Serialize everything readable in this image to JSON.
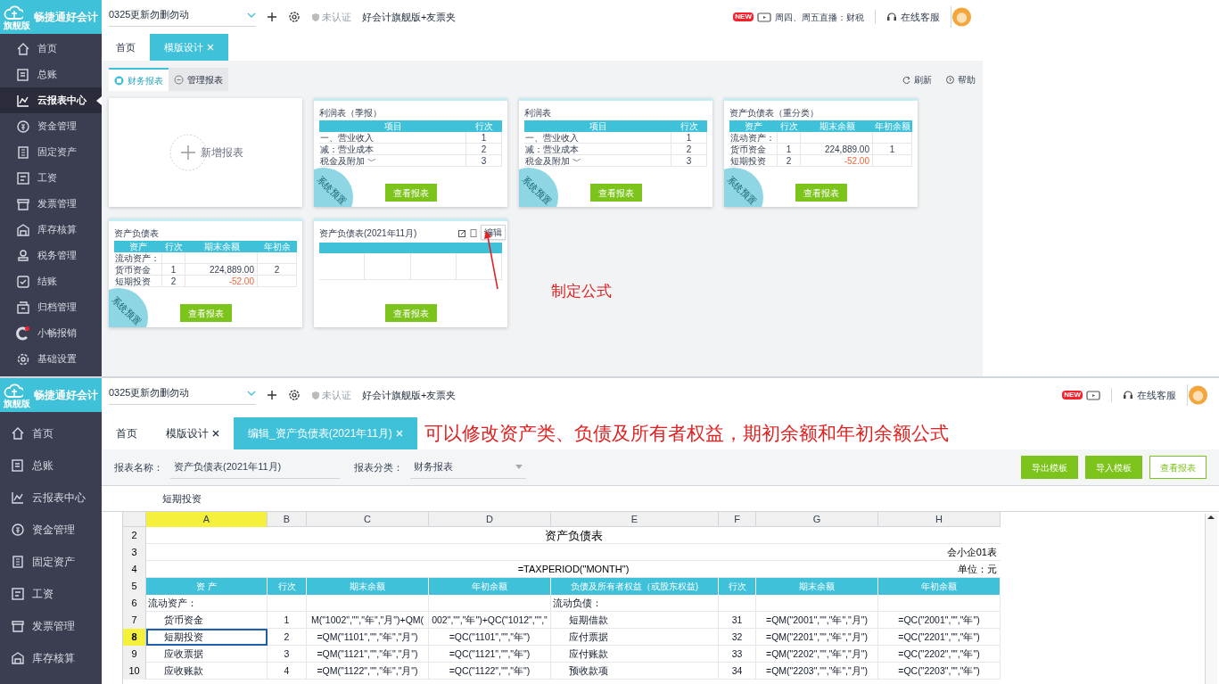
{
  "top_screen": {
    "logo": {
      "name": "畅捷通好会计",
      "edition": "旗舰版"
    },
    "sidebar": {
      "items": [
        {
          "label": "首页",
          "selected": false,
          "alert": false
        },
        {
          "label": "总账",
          "selected": false,
          "alert": false
        },
        {
          "label": "云报表中心",
          "selected": true,
          "alert": false
        },
        {
          "label": "资金管理",
          "selected": false,
          "alert": false
        },
        {
          "label": "固定资产",
          "selected": false,
          "alert": false
        },
        {
          "label": "工资",
          "selected": false,
          "alert": false
        },
        {
          "label": "发票管理",
          "selected": false,
          "alert": false
        },
        {
          "label": "库存核算",
          "selected": false,
          "alert": false
        },
        {
          "label": "税务管理",
          "selected": false,
          "alert": false
        },
        {
          "label": "结账",
          "selected": false,
          "alert": false
        },
        {
          "label": "归档管理",
          "selected": false,
          "alert": false
        },
        {
          "label": "小畅报销",
          "selected": false,
          "alert": true
        },
        {
          "label": "基础设置",
          "selected": false,
          "alert": false
        }
      ]
    },
    "header": {
      "account": "0325更新勿删勿动",
      "certification": "未认证",
      "product": "好会计旗舰版+友票夹",
      "live_badge": "NEW",
      "live": "周四、周五直播：财税",
      "support": "在线客服"
    },
    "tabs": [
      {
        "label": "首页",
        "closable": false,
        "selected": false
      },
      {
        "label": "模版设计",
        "closable": true,
        "selected": true
      }
    ],
    "subtabs": [
      {
        "label": "财务报表",
        "selected": true
      },
      {
        "label": "管理报表",
        "selected": false
      }
    ],
    "actions": [
      "刷新",
      "帮助"
    ],
    "cards": [
      {
        "kind": "add",
        "label": "新增报表"
      },
      {
        "kind": "report",
        "title": "利润表（季报）",
        "preset": "系统预置",
        "columns": [
          "项目",
          "行次"
        ],
        "rows": [
          [
            "一、营业收入",
            "1"
          ],
          [
            "减：营业成本",
            "2"
          ],
          [
            "税金及附加 ﹀",
            "3"
          ]
        ],
        "button": "查看报表"
      },
      {
        "kind": "report",
        "title": "利润表",
        "preset": "系统预置",
        "columns": [
          "项目",
          "行次"
        ],
        "rows": [
          [
            "一、营业收入",
            "1"
          ],
          [
            "减：营业成本",
            "2"
          ],
          [
            "税金及附加 ﹀",
            "3"
          ]
        ],
        "button": "查看报表"
      },
      {
        "kind": "report",
        "title": "资产负债表（重分类）",
        "preset": "系统预置",
        "columns": [
          "资产",
          "行次",
          "期末余额",
          "年初余额"
        ],
        "rows": [
          [
            "流动资产：",
            "",
            "",
            ""
          ],
          [
            "货币资金",
            "1",
            "224,889.00",
            "1"
          ],
          [
            "短期投资",
            "2",
            "-52.00",
            ""
          ]
        ],
        "button": "查看报表"
      },
      {
        "kind": "report",
        "title": "资产负债表",
        "preset": "系统预置",
        "columns": [
          "资产",
          "行次",
          "期末余额",
          "年初余"
        ],
        "rows": [
          [
            "流动资产：",
            "",
            "",
            ""
          ],
          [
            "货币资金",
            "1",
            "224,889.00",
            "2"
          ],
          [
            "短期投资",
            "2",
            "-52.00",
            ""
          ]
        ],
        "button": "查看报表"
      },
      {
        "kind": "custom",
        "title": "资产负债表(2021年11月)",
        "tooltip": "编辑",
        "button": "查看报表"
      }
    ],
    "annotation": "制定公式"
  },
  "bottom_screen": {
    "logo": {
      "name": "畅捷通好会计",
      "edition": "旗舰版"
    },
    "sidebar": {
      "items": [
        {
          "label": "首页"
        },
        {
          "label": "总账"
        },
        {
          "label": "云报表中心"
        },
        {
          "label": "资金管理"
        },
        {
          "label": "固定资产"
        },
        {
          "label": "工资"
        },
        {
          "label": "发票管理"
        },
        {
          "label": "库存核算"
        }
      ]
    },
    "header": {
      "account": "0325更新勿删勿动",
      "certification": "未认证",
      "product": "好会计旗舰版+友票夹",
      "live_badge": "NEW",
      "support": "在线客服"
    },
    "tabs": [
      {
        "label": "首页",
        "closable": false,
        "selected": false
      },
      {
        "label": "模版设计",
        "closable": true,
        "selected": false
      },
      {
        "label": "编辑_资产负债表(2021年11月)",
        "closable": true,
        "selected": true
      }
    ],
    "annotation": "可以修改资产类、负债及所有者权益，期初余额和年初余额公式",
    "form": {
      "name_label": "报表名称：",
      "name_value": "资产负债表(2021年11月)",
      "category_label": "报表分类：",
      "category_value": "财务报表"
    },
    "buttons": [
      {
        "label": "导出模板",
        "kind": "primary"
      },
      {
        "label": "导入模板",
        "kind": "primary"
      },
      {
        "label": "查看报表",
        "kind": "outline"
      }
    ],
    "formula_bar": "短期投资",
    "sheet": {
      "columns": [
        {
          "label": "A",
          "selected": true
        },
        {
          "label": "B",
          "selected": false
        },
        {
          "label": "C",
          "selected": false
        },
        {
          "label": "D",
          "selected": false
        },
        {
          "label": "E",
          "selected": false
        },
        {
          "label": "F",
          "selected": false
        },
        {
          "label": "G",
          "selected": false
        },
        {
          "label": "H",
          "selected": false
        }
      ],
      "rows": [
        {
          "kind": "banner",
          "number": "2",
          "selected": false,
          "center": "资产负债表"
        },
        {
          "kind": "banner",
          "number": "3",
          "selected": false,
          "right": "会小企01表"
        },
        {
          "kind": "banner",
          "number": "4",
          "selected": false,
          "center": "=TAXPERIOD(\"MONTH\")",
          "right": "单位：元"
        },
        {
          "kind": "header",
          "number": "5",
          "selected": false,
          "cells": [
            "资 产",
            "行次",
            "期末余额",
            "年初余额",
            "负债及所有者权益（或股东权益)",
            "行次",
            "期末余额",
            "年初余额"
          ]
        },
        {
          "kind": "data",
          "number": "6",
          "selected": false,
          "indented": false,
          "cells": [
            "流动资产：",
            "",
            "",
            "",
            "流动负债：",
            "",
            "",
            ""
          ]
        },
        {
          "kind": "data",
          "number": "7",
          "selected": false,
          "indented": true,
          "cells": [
            "货币资金",
            "1",
            "M(\"1002\",\"\",\"年\",\"月\")+QM(",
            "002\",\"\",\"年\")+QC(\"1012\",\"\",\"",
            "短期借款",
            "31",
            "=QM(\"2001\",\"\",\"年\",\"月\")",
            "=QC(\"2001\",\"\",\"年\")"
          ]
        },
        {
          "kind": "data",
          "number": "8",
          "selected": true,
          "indented": true,
          "cells": [
            "短期投资",
            "2",
            "=QM(\"1101\",\"\",\"年\",\"月\")",
            "=QC(\"1101\",\"\",\"年\")",
            "应付票据",
            "32",
            "=QM(\"2201\",\"\",\"年\",\"月\")",
            "=QC(\"2201\",\"\",\"年\")"
          ]
        },
        {
          "kind": "data",
          "number": "9",
          "selected": false,
          "indented": true,
          "cells": [
            "应收票据",
            "3",
            "=QM(\"1121\",\"\",\"年\",\"月\")",
            "=QC(\"1121\",\"\",\"年\")",
            "应付账款",
            "33",
            "=QM(\"2202\",\"\",\"年\",\"月\")",
            "=QC(\"2202\",\"\",\"年\")"
          ]
        },
        {
          "kind": "data",
          "number": "10",
          "selected": false,
          "indented": true,
          "cells": [
            "应收账款",
            "4",
            "=QM(\"1122\",\"\",\"年\",\"月\")",
            "=QC(\"1122\",\"\",\"年\")",
            "预收款项",
            "34",
            "=QM(\"2203\",\"\",\"年\",\"月\")",
            "=QC(\"2203\",\"\",\"年\")"
          ]
        }
      ]
    }
  }
}
